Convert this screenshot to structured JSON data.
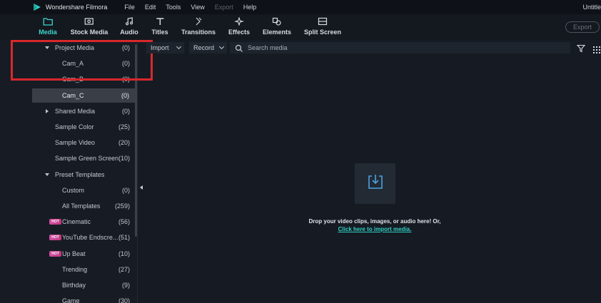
{
  "titlebar": {
    "app_title": "Wondershare Filmora",
    "menu": [
      {
        "label": "File",
        "disabled": false
      },
      {
        "label": "Edit",
        "disabled": false
      },
      {
        "label": "Tools",
        "disabled": false
      },
      {
        "label": "View",
        "disabled": false
      },
      {
        "label": "Export",
        "disabled": true
      },
      {
        "label": "Help",
        "disabled": false
      }
    ],
    "document_title": "Untitle"
  },
  "tabs": [
    {
      "label": "Media",
      "icon": "folder-icon",
      "active": true
    },
    {
      "label": "Stock Media",
      "icon": "cloud-icon",
      "active": false
    },
    {
      "label": "Audio",
      "icon": "music-note-icon",
      "active": false
    },
    {
      "label": "Titles",
      "icon": "text-t-icon",
      "active": false
    },
    {
      "label": "Transitions",
      "icon": "transitions-icon",
      "active": false
    },
    {
      "label": "Effects",
      "icon": "sparkle-icon",
      "active": false
    },
    {
      "label": "Elements",
      "icon": "shapes-icon",
      "active": false
    },
    {
      "label": "Split Screen",
      "icon": "split-screen-icon",
      "active": false
    }
  ],
  "export_button": "Export",
  "sidebar": {
    "items": [
      {
        "label": "Project Media",
        "count": "(0)",
        "caret": "down",
        "indent": 1,
        "hot": false,
        "selected": false
      },
      {
        "label": "Cam_A",
        "count": "(0)",
        "caret": "",
        "indent": 2,
        "hot": false,
        "selected": false
      },
      {
        "label": "Cam_B",
        "count": "(0)",
        "caret": "",
        "indent": 2,
        "hot": false,
        "selected": false
      },
      {
        "label": "Cam_C",
        "count": "(0)",
        "caret": "",
        "indent": 2,
        "hot": false,
        "selected": true
      },
      {
        "label": "Shared Media",
        "count": "(0)",
        "caret": "right",
        "indent": 1,
        "hot": false,
        "selected": false
      },
      {
        "label": "Sample Color",
        "count": "(25)",
        "caret": "",
        "indent": 1,
        "hot": false,
        "selected": false
      },
      {
        "label": "Sample Video",
        "count": "(20)",
        "caret": "",
        "indent": 1,
        "hot": false,
        "selected": false
      },
      {
        "label": "Sample Green Screen",
        "count": "(10)",
        "caret": "",
        "indent": 1,
        "hot": false,
        "selected": false
      },
      {
        "label": "Preset Templates",
        "count": "",
        "caret": "down",
        "indent": 1,
        "hot": false,
        "selected": false
      },
      {
        "label": "Custom",
        "count": "(0)",
        "caret": "",
        "indent": 2,
        "hot": false,
        "selected": false
      },
      {
        "label": "All Templates",
        "count": "(259)",
        "caret": "",
        "indent": 2,
        "hot": false,
        "selected": false
      },
      {
        "label": "Cinematic",
        "count": "(56)",
        "caret": "",
        "indent": 1,
        "hot": true,
        "selected": false
      },
      {
        "label": "YouTube Endscre...",
        "count": "(51)",
        "caret": "",
        "indent": 1,
        "hot": true,
        "selected": false
      },
      {
        "label": "Up Beat",
        "count": "(10)",
        "caret": "",
        "indent": 1,
        "hot": true,
        "selected": false
      },
      {
        "label": "Trending",
        "count": "(27)",
        "caret": "",
        "indent": 2,
        "hot": false,
        "selected": false
      },
      {
        "label": "Birthday",
        "count": "(9)",
        "caret": "",
        "indent": 2,
        "hot": false,
        "selected": false
      },
      {
        "label": "Game",
        "count": "(30)",
        "caret": "",
        "indent": 2,
        "hot": false,
        "selected": false
      }
    ],
    "hot_badge": "HOT"
  },
  "media_toolbar": {
    "import_label": "Import",
    "record_label": "Record",
    "search_placeholder": "Search media"
  },
  "dropzone": {
    "message": "Drop your video clips, images, or audio here! Or,",
    "link": "Click here to import media."
  },
  "colors": {
    "accent": "#3fd4cc",
    "highlight_box": "#d8282c",
    "hot_badge": "#d14ea8"
  }
}
